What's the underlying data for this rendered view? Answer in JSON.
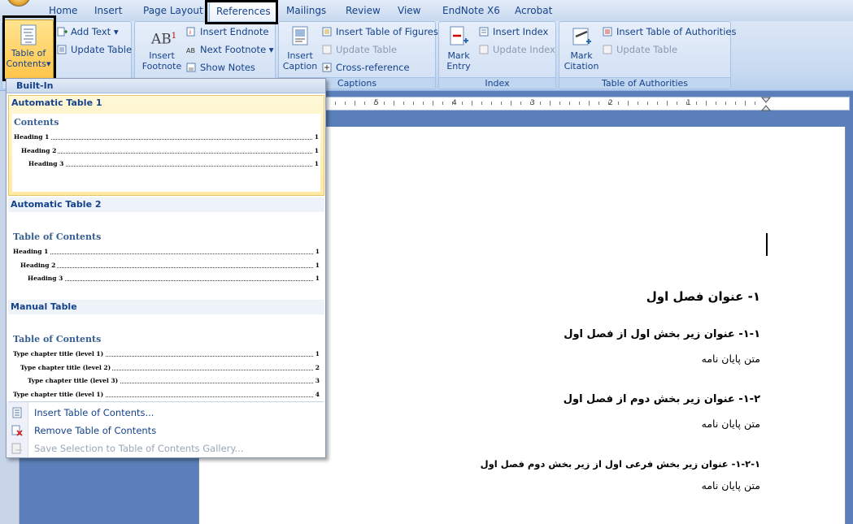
{
  "tabs": [
    "Home",
    "Insert",
    "Page Layout",
    "References",
    "Mailings",
    "Review",
    "View",
    "EndNote X6",
    "Acrobat"
  ],
  "active_tab": "References",
  "ribbon": {
    "toc_button": "Table of Contents",
    "toc_line1": "Table of",
    "toc_line2": "Contents",
    "add_text": "Add Text",
    "update_table": "Update Table",
    "insert_footnote_1": "Insert",
    "insert_footnote_2": "Footnote",
    "insert_endnote": "Insert Endnote",
    "next_footnote": "Next Footnote",
    "show_notes": "Show Notes",
    "insert_caption_1": "Insert",
    "insert_caption_2": "Caption",
    "insert_table_of_figures": "Insert Table of Figures",
    "update_table_figures": "Update Table",
    "cross_reference": "Cross-reference",
    "captions_label": "Captions",
    "mark_entry_1": "Mark",
    "mark_entry_2": "Entry",
    "insert_index": "Insert Index",
    "update_index": "Update Index",
    "index_label": "Index",
    "mark_citation_1": "Mark",
    "mark_citation_2": "Citation",
    "insert_table_of_authorities": "Insert Table of Authorities",
    "update_table_authorities": "Update Table",
    "authorities_label": "Table of Authorities"
  },
  "ruler": {
    "numbers": [
      "5",
      "4",
      "3",
      "2",
      "1"
    ]
  },
  "dropdown": {
    "header": "Built-In",
    "auto1": {
      "title": "Automatic Table 1",
      "heading": "Contents",
      "lines": [
        {
          "text": "Heading 1",
          "page": "1"
        },
        {
          "text": "Heading 2",
          "page": "1"
        },
        {
          "text": "Heading 3",
          "page": "1"
        }
      ]
    },
    "auto2": {
      "title": "Automatic Table 2",
      "heading": "Table of Contents",
      "lines": [
        {
          "text": "Heading 1",
          "page": "1"
        },
        {
          "text": "Heading 2",
          "page": "1"
        },
        {
          "text": "Heading 3",
          "page": "1"
        }
      ]
    },
    "manual": {
      "title": "Manual Table",
      "heading": "Table of Contents",
      "lines": [
        {
          "text": "Type chapter title (level 1)",
          "page": "1"
        },
        {
          "text": "Type chapter title (level 2)",
          "page": "2"
        },
        {
          "text": "Type chapter title (level 3)",
          "page": "3"
        },
        {
          "text": "Type chapter title (level 1)",
          "page": "4"
        }
      ]
    },
    "commands": {
      "insert": "Insert Table of Contents...",
      "remove": "Remove Table of Contents",
      "save": "Save Selection to Table of Contents Gallery..."
    }
  },
  "document": {
    "h1": "۱- عنوان فصل اول",
    "h2a": "۱-۱- عنوان زیر بخش اول از فصل اول",
    "body_a": "متن پایان نامه",
    "h2b": "۱-۲- عنوان زیر بخش دوم از فصل اول",
    "body_b": "متن پایان نامه",
    "h3": "۱-۲-۱- عنوان زیر بخش فرعی اول از زیر بخش دوم فصل اول",
    "body_c": "متن پایان نامه"
  },
  "colors": {
    "ribbon_text": "#15428b",
    "highlight": "#ffc54a",
    "doc_background": "#5b7fba"
  }
}
